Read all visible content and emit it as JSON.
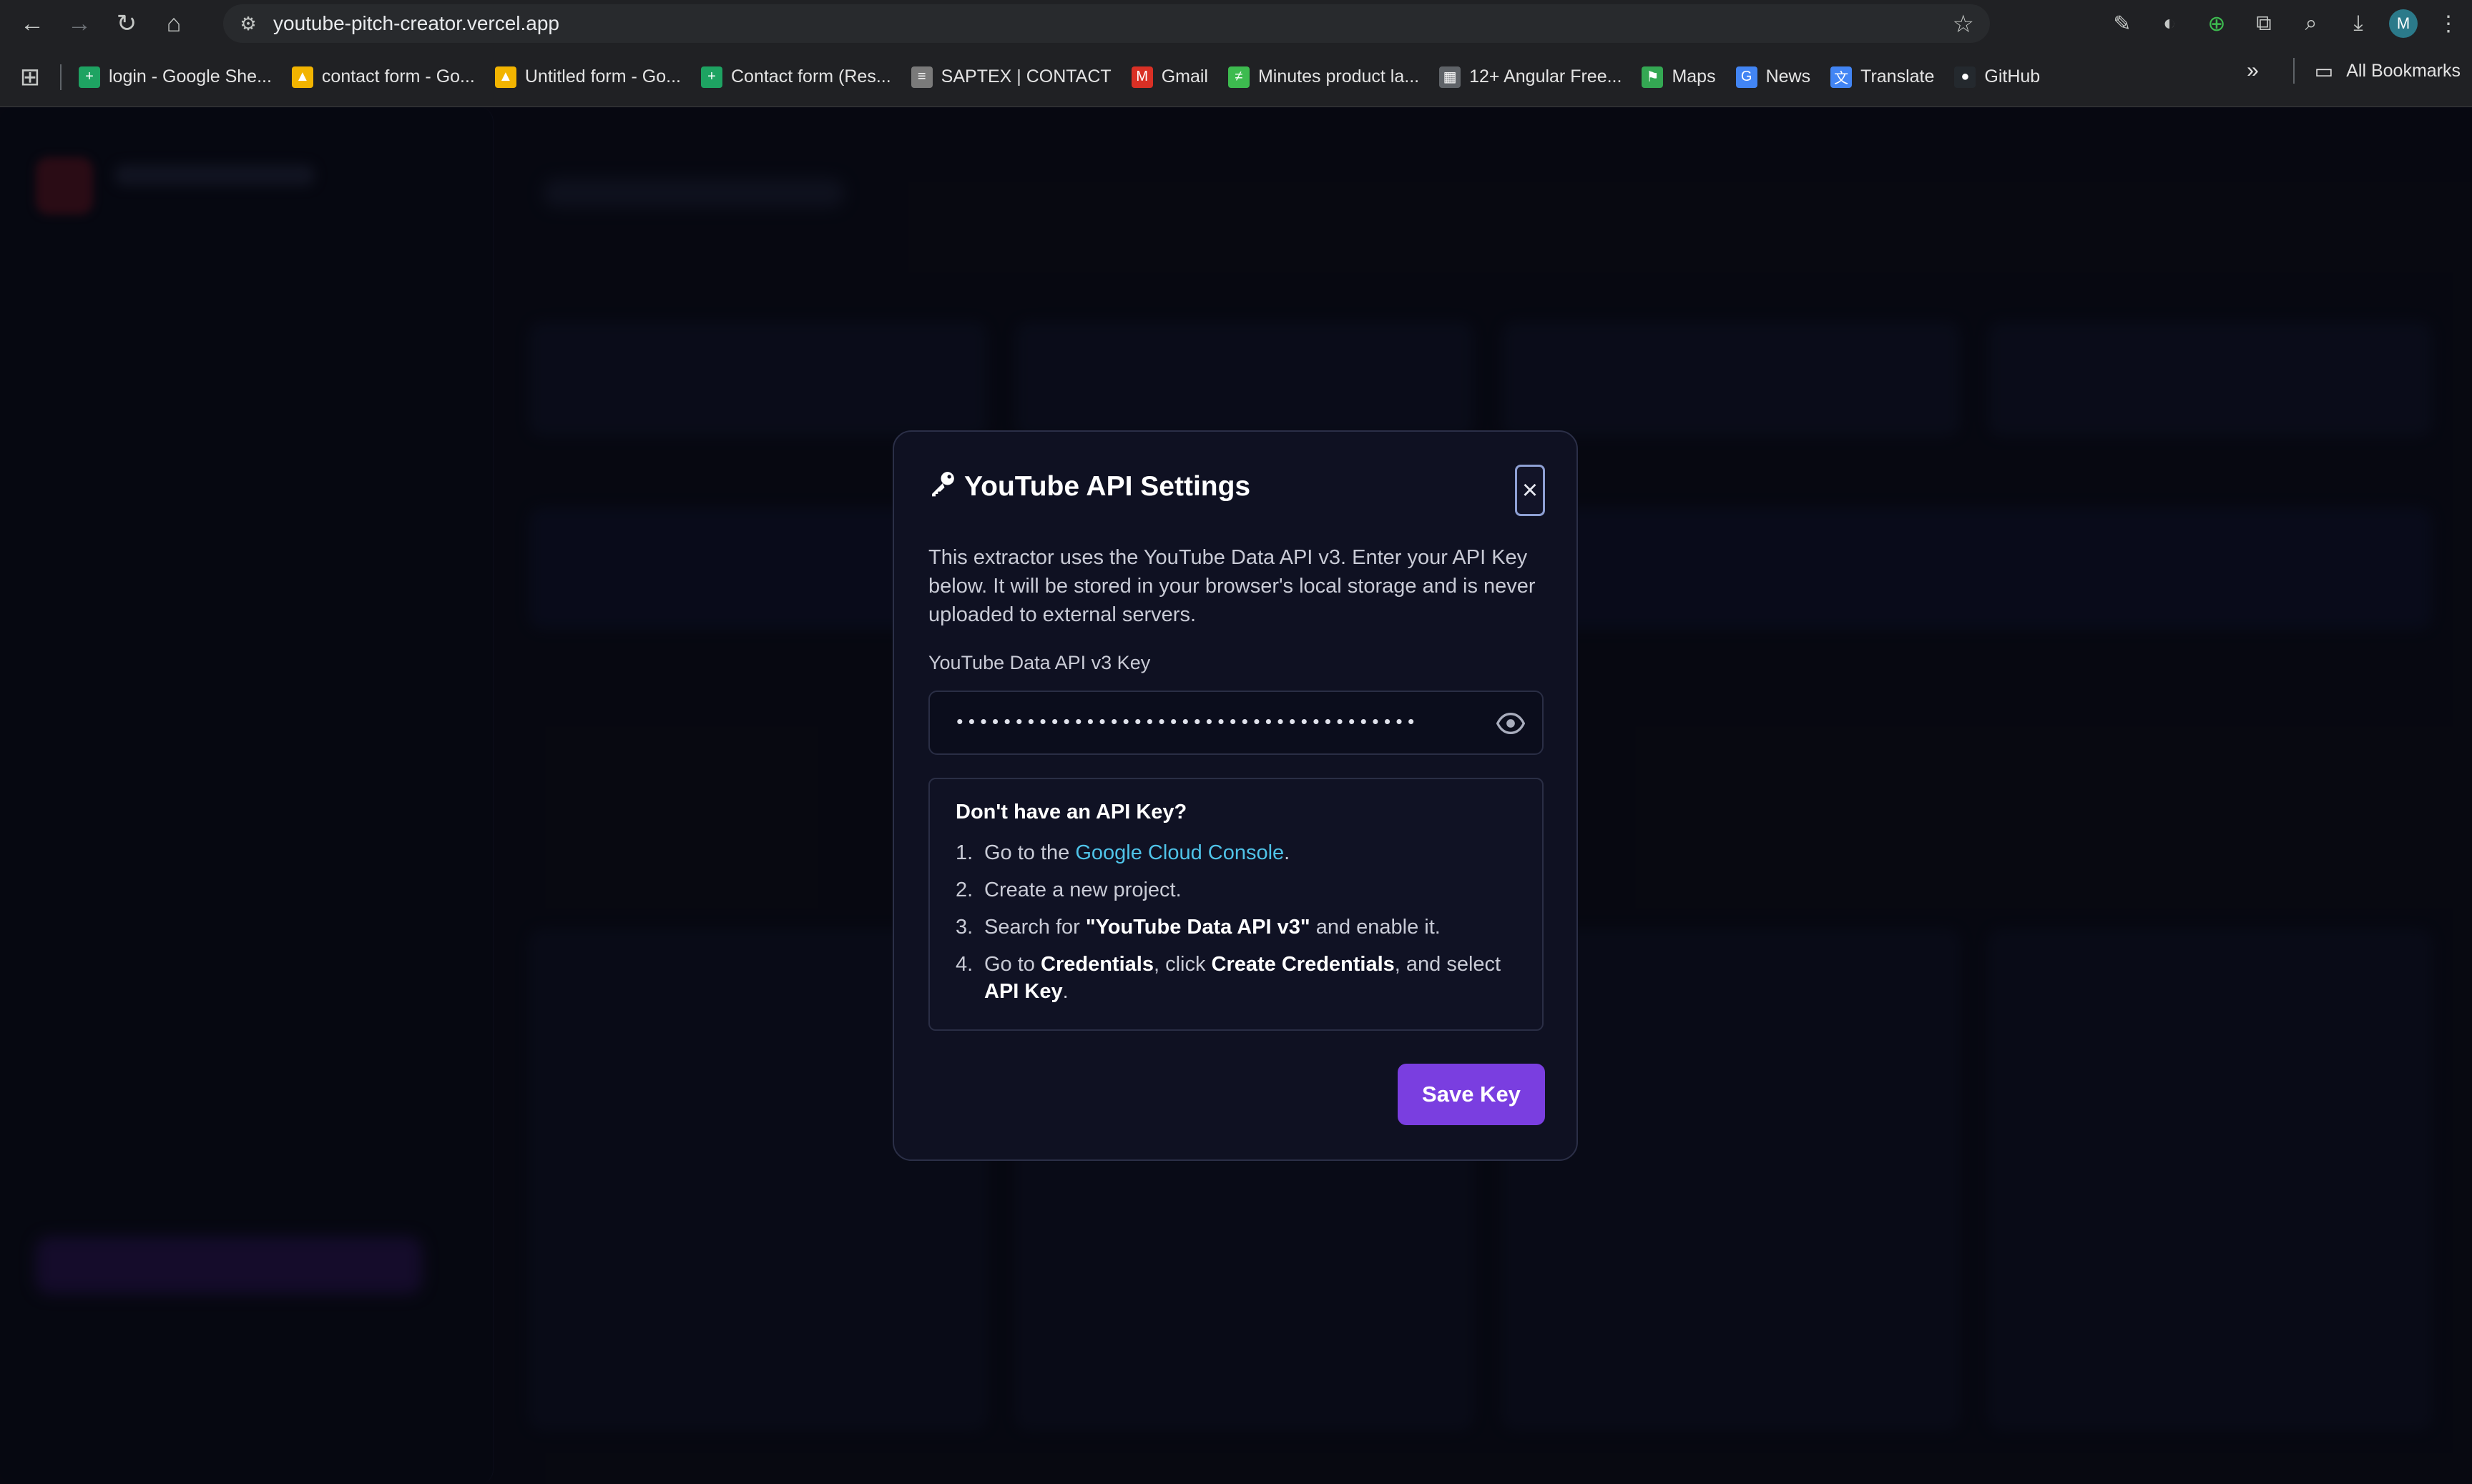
{
  "browser": {
    "url": "youtube-pitch-creator.vercel.app",
    "profile_initial": "M",
    "bookmarks": [
      {
        "label": "login - Google She...",
        "icon": "sheets-icon",
        "color": "#1ea362",
        "glyph": "+"
      },
      {
        "label": "contact form - Go...",
        "icon": "drive-icon",
        "color": "#f2b400",
        "glyph": "▲"
      },
      {
        "label": "Untitled form - Go...",
        "icon": "drive-icon",
        "color": "#f2b400",
        "glyph": "▲"
      },
      {
        "label": "Contact form (Res...",
        "icon": "sheets-icon",
        "color": "#1ea362",
        "glyph": "+"
      },
      {
        "label": "SAPTEX | CONTACT",
        "icon": "saptex-icon",
        "color": "#7a7a7a",
        "glyph": "≡"
      },
      {
        "label": "Gmail",
        "icon": "gmail-icon",
        "color": "#d93025",
        "glyph": "M"
      },
      {
        "label": "Minutes product la...",
        "icon": "minutes-icon",
        "color": "#3dbb4f",
        "glyph": "≠"
      },
      {
        "label": "12+ Angular Free...",
        "icon": "template-icon",
        "color": "#5f6368",
        "glyph": "▦"
      },
      {
        "label": "Maps",
        "icon": "maps-icon",
        "color": "#34a853",
        "glyph": "⚑"
      },
      {
        "label": "News",
        "icon": "news-icon",
        "color": "#4285f4",
        "glyph": "G"
      },
      {
        "label": "Translate",
        "icon": "translate-icon",
        "color": "#4285f4",
        "glyph": "文"
      },
      {
        "label": "GitHub",
        "icon": "github-icon",
        "color": "#24292e",
        "glyph": "●"
      }
    ],
    "all_bookmarks": "All Bookmarks"
  },
  "modal": {
    "title": "YouTube API Settings",
    "description": "This extractor uses the YouTube Data API v3. Enter your API Key below. It will be stored in your browser's local storage and is never uploaded to external servers.",
    "field_label": "YouTube Data API v3 Key",
    "key_value": "•••••••••••••••••••••••••••••••••••••••",
    "help_title": "Don't have an API Key?",
    "steps": [
      {
        "num": "1.",
        "pre": "Go to the ",
        "link": "Google Cloud Console",
        "post": "."
      },
      {
        "num": "2.",
        "text": "Create a new project."
      },
      {
        "num": "3.",
        "pre": "Search for ",
        "bold": "\"YouTube Data API v3\"",
        "post": " and enable it."
      },
      {
        "num": "4.",
        "pre": "Go to ",
        "bold1": "Credentials",
        "mid": ", click ",
        "bold2": "Create Credentials",
        "mid2": ", and select ",
        "bold3": "API Key",
        "post": "."
      }
    ],
    "save_label": "Save Key",
    "close_label": "×"
  },
  "colors": {
    "accent": "#7a3ee0",
    "link": "#4fc3e8"
  }
}
